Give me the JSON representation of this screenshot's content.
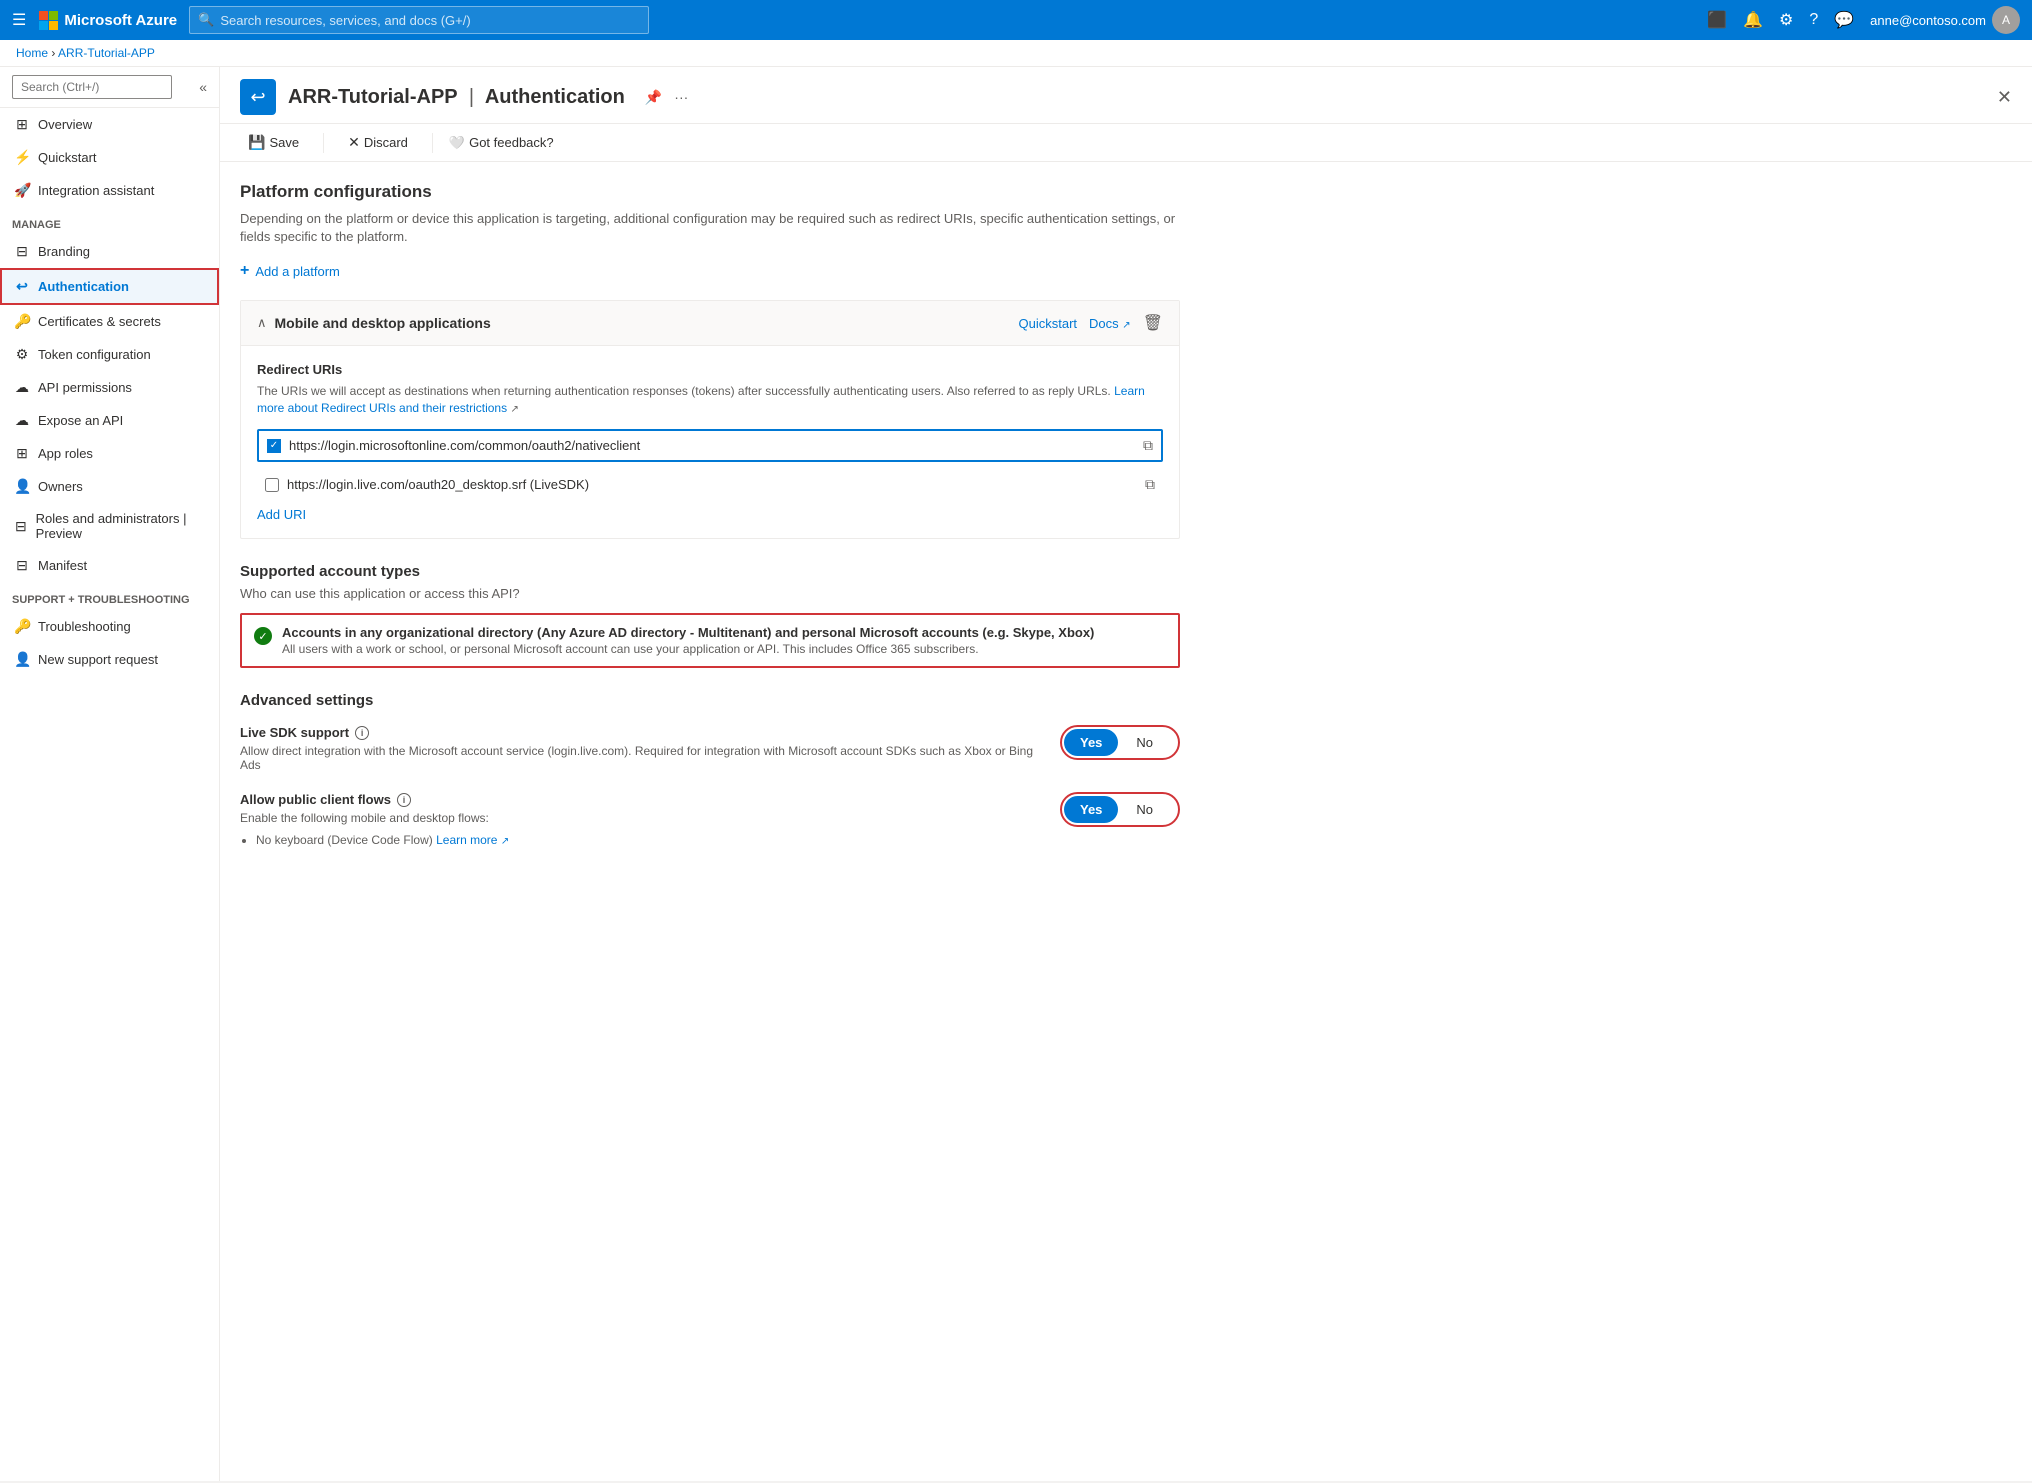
{
  "topbar": {
    "app_name": "Microsoft Azure",
    "search_placeholder": "Search resources, services, and docs (G+/)",
    "user_email": "anne@contoso.com"
  },
  "breadcrumb": {
    "home": "Home",
    "app": "ARR-Tutorial-APP"
  },
  "page_header": {
    "title": "ARR-Tutorial-APP",
    "subtitle": "Authentication"
  },
  "toolbar": {
    "save_label": "Save",
    "discard_label": "Discard",
    "feedback_label": "Got feedback?"
  },
  "platform_configs": {
    "title": "Platform configurations",
    "description": "Depending on the platform or device this application is targeting, additional configuration may be required such as redirect URIs, specific authentication settings, or fields specific to the platform.",
    "add_platform_label": "Add a platform"
  },
  "mobile_desktop": {
    "title": "Mobile and desktop applications",
    "quickstart_label": "Quickstart",
    "docs_label": "Docs",
    "redirect_uris_title": "Redirect URIs",
    "redirect_desc": "The URIs we will accept as destinations when returning authentication responses (tokens) after successfully authenticating users. Also referred to as reply URLs.",
    "redirect_link_text": "Learn more about Redirect URIs and their restrictions",
    "uri_1": "https://login.microsoftonline.com/common/oauth2/nativeclient",
    "uri_2": "https://login.live.com/oauth20_desktop.srf (LiveSDK)",
    "add_uri_label": "Add URI"
  },
  "supported_accounts": {
    "title": "Supported account types",
    "question": "Who can use this application or access this API?",
    "selected_option": {
      "title": "Accounts in any organizational directory (Any Azure AD directory - Multitenant) and personal Microsoft accounts (e.g. Skype, Xbox)",
      "description": "All users with a work or school, or personal Microsoft account can use your application or API. This includes Office 365 subscribers."
    }
  },
  "advanced_settings": {
    "title": "Advanced settings",
    "live_sdk": {
      "label": "Live SDK support",
      "description": "Allow direct integration with the Microsoft account service (login.live.com). Required for integration with Microsoft account SDKs such as Xbox or Bing Ads",
      "yes_label": "Yes",
      "no_label": "No"
    },
    "public_client": {
      "label": "Allow public client flows",
      "description": "Enable the following mobile and desktop flows:",
      "yes_label": "Yes",
      "no_label": "No",
      "bullet_1": "No keyboard (Device Code Flow)",
      "learn_more": "Learn more"
    }
  },
  "sidebar": {
    "search_placeholder": "Search (Ctrl+/)",
    "items": [
      {
        "id": "overview",
        "label": "Overview",
        "icon": "⊞"
      },
      {
        "id": "quickstart",
        "label": "Quickstart",
        "icon": "⚡"
      },
      {
        "id": "integration",
        "label": "Integration assistant",
        "icon": "🚀"
      }
    ],
    "manage_label": "Manage",
    "manage_items": [
      {
        "id": "branding",
        "label": "Branding",
        "icon": "⊟"
      },
      {
        "id": "authentication",
        "label": "Authentication",
        "icon": "↩",
        "active": true
      },
      {
        "id": "certs",
        "label": "Certificates & secrets",
        "icon": "🔑"
      },
      {
        "id": "token",
        "label": "Token configuration",
        "icon": "⚙"
      },
      {
        "id": "api",
        "label": "API permissions",
        "icon": "☁"
      },
      {
        "id": "expose",
        "label": "Expose an API",
        "icon": "☁"
      },
      {
        "id": "approles",
        "label": "App roles",
        "icon": "⊞"
      },
      {
        "id": "owners",
        "label": "Owners",
        "icon": "👤"
      },
      {
        "id": "roles",
        "label": "Roles and administrators | Preview",
        "icon": "⊟"
      },
      {
        "id": "manifest",
        "label": "Manifest",
        "icon": "⊟"
      }
    ],
    "support_label": "Support + Troubleshooting",
    "support_items": [
      {
        "id": "troubleshooting",
        "label": "Troubleshooting",
        "icon": "🔑"
      },
      {
        "id": "support",
        "label": "New support request",
        "icon": "👤"
      }
    ]
  }
}
